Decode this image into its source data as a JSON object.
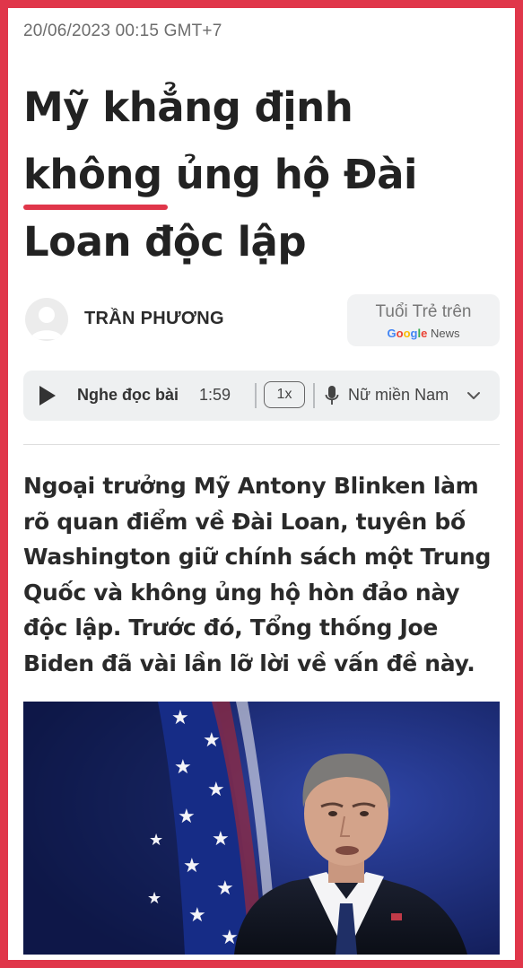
{
  "article": {
    "timestamp": "20/06/2023 00:15 GMT+7",
    "title_part1": "Mỹ khẳng định ",
    "title_highlight": "không",
    "title_part2": " ủng hộ Đài Loan độc lập",
    "author": "TRẦN PHƯƠNG",
    "lead": "Ngoại trưởng Mỹ Antony Blinken làm rõ quan điểm về Đài Loan, tuyên bố Washington giữ chính sách một Trung Quốc và không ủng hộ hòn đảo này độc lập. Trước đó, Tổng thống Joe Biden đã vài lần lỡ lời về vấn đề này."
  },
  "google_news": {
    "line1": "Tuổi Trẻ trên",
    "google": "Google",
    "news": " News"
  },
  "audio": {
    "listen_label": "Nghe đọc bài",
    "duration": "1:59",
    "speed": "1x",
    "voice": "Nữ miền Nam"
  },
  "colors": {
    "accent": "#e0364a",
    "google_letters": [
      "#4285F4",
      "#EA4335",
      "#FBBC05",
      "#4285F4",
      "#34A853",
      "#EA4335"
    ],
    "photo_background": "#1c2c74"
  },
  "icons": [
    "play-icon",
    "mic-icon",
    "chevron-down-icon",
    "avatar-placeholder-icon"
  ]
}
